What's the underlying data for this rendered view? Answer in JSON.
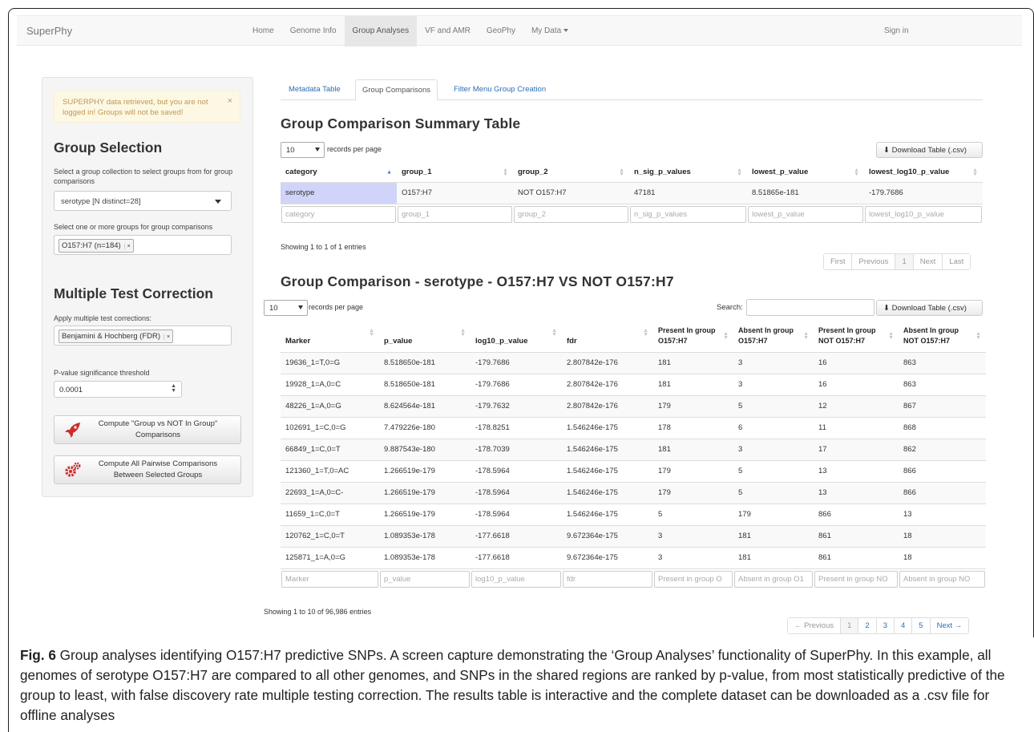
{
  "navbar": {
    "brand": "SuperPhy",
    "items": [
      "Home",
      "Genome Info",
      "Group Analyses",
      "VF and AMR",
      "GeoPhy",
      "My Data"
    ],
    "sign_in": "Sign in"
  },
  "sidebar": {
    "alert": "SUPERPHY data retrieved, but you are not logged in! Groups will not be saved!",
    "alert_close": "×",
    "group_selection_title": "Group Selection",
    "collection_help": "Select a group collection to select groups from for group comparisons",
    "collection_value": "serotype [N distinct=28]",
    "groups_help": "Select one or more groups for group comparisons",
    "group_tag": "O157:H7 (n=184)",
    "mtc_title": "Multiple Test Correction",
    "mtc_help": "Apply multiple test corrections:",
    "mtc_tag": "Benjamini & Hochberg (FDR)",
    "tag_remove": "×",
    "pval_label": "P-value significance threshold",
    "pval_value": "0.0001",
    "btn_group_vs_not": "Compute \"Group vs NOT In Group\" Comparisons",
    "btn_pairwise": "Compute All Pairwise Comparisons Between Selected Groups"
  },
  "tabs": [
    "Metadata Table",
    "Group Comparisons",
    "Filter Menu Group Creation"
  ],
  "summary": {
    "title": "Group Comparison Summary Table",
    "length_value": "10",
    "length_label": "records per page",
    "download": "Download Table (.csv)",
    "columns": [
      "category",
      "group_1",
      "group_2",
      "n_sig_p_values",
      "lowest_p_value",
      "lowest_log10_p_value"
    ],
    "rows": [
      [
        "serotype",
        "O157:H7",
        "NOT O157:H7",
        "47181",
        "8.51865e-181",
        "-179.7686"
      ]
    ],
    "info": "Showing 1 to 1 of 1 entries",
    "pager": [
      "First",
      "Previous",
      "1",
      "Next",
      "Last"
    ]
  },
  "comparison": {
    "title": "Group Comparison - serotype - O157:H7 VS NOT O157:H7",
    "length_value": "10",
    "length_label": "records per page",
    "search_label": "Search:",
    "download": "Download Table (.csv)",
    "columns": [
      "Marker",
      "p_value",
      "log10_p_value",
      "fdr",
      "Present In group O157:H7",
      "Absent In group O157:H7",
      "Present In group NOT O157:H7",
      "Absent In group NOT O157:H7"
    ],
    "rows": [
      [
        "19636_1=T,0=G",
        "8.518650e-181",
        "-179.7686",
        "2.807842e-176",
        "181",
        "3",
        "16",
        "863"
      ],
      [
        "19928_1=A,0=C",
        "8.518650e-181",
        "-179.7686",
        "2.807842e-176",
        "181",
        "3",
        "16",
        "863"
      ],
      [
        "48226_1=A,0=G",
        "8.624564e-181",
        "-179.7632",
        "2.807842e-176",
        "179",
        "5",
        "12",
        "867"
      ],
      [
        "102691_1=C,0=G",
        "7.479226e-180",
        "-178.8251",
        "1.546246e-175",
        "178",
        "6",
        "11",
        "868"
      ],
      [
        "66849_1=C,0=T",
        "9.887543e-180",
        "-178.7039",
        "1.546246e-175",
        "181",
        "3",
        "17",
        "862"
      ],
      [
        "121360_1=T,0=AC",
        "1.266519e-179",
        "-178.5964",
        "1.546246e-175",
        "179",
        "5",
        "13",
        "866"
      ],
      [
        "22693_1=A,0=C-",
        "1.266519e-179",
        "-178.5964",
        "1.546246e-175",
        "179",
        "5",
        "13",
        "866"
      ],
      [
        "11659_1=C,0=T",
        "1.266519e-179",
        "-178.5964",
        "1.546246e-175",
        "5",
        "179",
        "866",
        "13"
      ],
      [
        "120762_1=C,0=T",
        "1.089353e-178",
        "-177.6618",
        "9.672364e-175",
        "3",
        "181",
        "861",
        "18"
      ],
      [
        "125871_1=A,0=G",
        "1.089353e-178",
        "-177.6618",
        "9.672364e-175",
        "3",
        "181",
        "861",
        "18"
      ]
    ],
    "filters": [
      "Marker",
      "p_value",
      "log10_p_value",
      "fdr",
      "Present in group O",
      "Absent in group O1",
      "Present in group NO",
      "Absent in group NO"
    ],
    "info": "Showing 1 to 10 of 96,986 entries",
    "pager": [
      "← Previous",
      "1",
      "2",
      "3",
      "4",
      "5",
      "Next →"
    ]
  },
  "caption": {
    "label": "Fig. 6",
    "text": " Group analyses identifying O157:H7 predictive SNPs. A screen capture demonstrating the ‘Group Analyses’ functionality of SuperPhy. In this example, all genomes of serotype O157:H7 are compared to all other genomes, and SNPs in the shared regions are ranked by p-value, from most statistically predictive of the group to least, with false discovery rate multiple testing correction. The results table is interactive and the complete dataset can be downloaded as a .csv file for offline analyses"
  },
  "colors": {
    "link": "#2a6fb5",
    "highlight": "#d0d4f8",
    "alert_bg": "#fcf8e3",
    "alert_text": "#c09853"
  },
  "icons": {
    "alert_close": "close-icon",
    "group_vs_not": "rocket-icon",
    "pairwise": "gears-icon",
    "download": "download-icon"
  }
}
